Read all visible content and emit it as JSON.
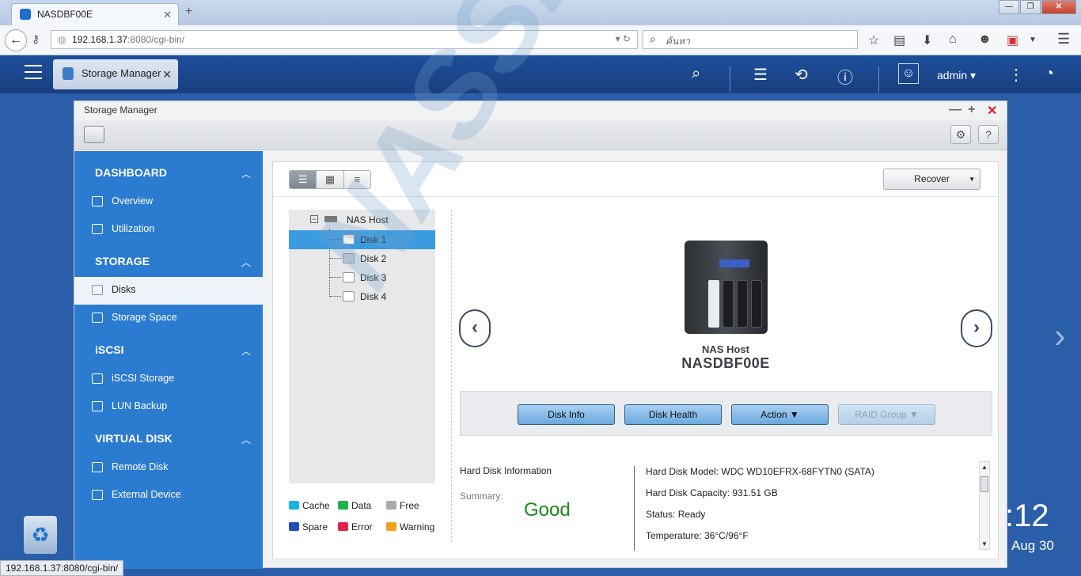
{
  "browser": {
    "tab_title": "NASDBF00E",
    "url_host": "192.168.1.37",
    "url_path": ":8080/cgi-bin/",
    "search_placeholder": "ค้นหา",
    "status_url": "192.168.1.37:8080/cgi-bin/"
  },
  "qnap": {
    "app_tab_label": "Storage Manager",
    "user": "admin ▾"
  },
  "window": {
    "title": "Storage Manager"
  },
  "sidebar": {
    "sections": [
      {
        "label": "DASHBOARD",
        "items": [
          "Overview",
          "Utilization"
        ]
      },
      {
        "label": "STORAGE",
        "items": [
          "Disks",
          "Storage Space"
        ]
      },
      {
        "label": "iSCSI",
        "items": [
          "iSCSI Storage",
          "LUN Backup"
        ]
      },
      {
        "label": "VIRTUAL DISK",
        "items": [
          "Remote Disk",
          "External Device"
        ]
      }
    ]
  },
  "toolbar": {
    "recover_label": "Recover"
  },
  "tree": {
    "root": "NAS Host",
    "disks": [
      "Disk 1",
      "Disk 2",
      "Disk 3",
      "Disk 4"
    ],
    "selected": "Disk 1"
  },
  "legend": {
    "items": [
      {
        "label": "Cache",
        "color": "#18b6e0"
      },
      {
        "label": "Data",
        "color": "#1db34a"
      },
      {
        "label": "Free",
        "color": "#a7abb0"
      },
      {
        "label": "Spare",
        "color": "#1f4fb4"
      },
      {
        "label": "Error",
        "color": "#e0224a"
      },
      {
        "label": "Warning",
        "color": "#f0a020"
      }
    ]
  },
  "host": {
    "caption": "NAS Host",
    "name": "NASDBF00E"
  },
  "actions": {
    "disk_info": "Disk Info",
    "disk_health": "Disk Health",
    "action": "Action ▼",
    "raid_group": "RAID Group ▼"
  },
  "info": {
    "heading": "Hard Disk Information",
    "summary_label": "Summary:",
    "summary_value": "Good",
    "model": "Hard Disk Model: WDC WD10EFRX-68FYTN0 (SATA)",
    "capacity": "Hard Disk Capacity: 931.51 GB",
    "status": "Status: Ready",
    "temperature": "Temperature: 36°C/96°F"
  },
  "desktop": {
    "clock": ":12",
    "date": "Aug 30",
    "watermark": "NASSHOPS.net"
  }
}
